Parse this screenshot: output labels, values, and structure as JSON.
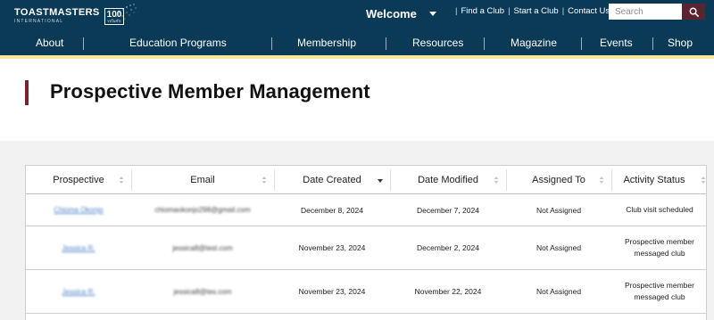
{
  "brand": {
    "name": "TOASTMASTERS",
    "sub": "INTERNATIONAL",
    "badge_number": "100",
    "badge_sub": "YEARS"
  },
  "header": {
    "welcome": "Welcome",
    "links": [
      "Find a Club",
      "Start a Club",
      "Contact Us"
    ],
    "search_placeholder": "Search"
  },
  "nav": [
    "About",
    "Education Programs",
    "Membership",
    "Resources",
    "Magazine",
    "Events",
    "Shop"
  ],
  "page": {
    "title": "Prospective Member Management"
  },
  "table": {
    "columns": [
      "Prospective",
      "Email",
      "Date Created",
      "Date Modified",
      "Assigned To",
      "Activity Status"
    ],
    "rows": [
      {
        "prospective": "Chioma Okonjo",
        "email": "chiomaokonjo298@gmail.com",
        "date_created": "December 8, 2024",
        "date_modified": "December 7, 2024",
        "assigned_to": "Not Assigned",
        "status": "Club visit scheduled"
      },
      {
        "prospective": "Jessica R.",
        "email": "jessica8@test.com",
        "date_created": "November 23, 2024",
        "date_modified": "December 2, 2024",
        "assigned_to": "Not Assigned",
        "status": "Prospective member messaged club"
      },
      {
        "prospective": "Jessica R.",
        "email": "jessica8@tes.com",
        "date_created": "November 23, 2024",
        "date_modified": "November 22, 2024",
        "assigned_to": "Not Assigned",
        "status": "Prospective member messaged club"
      }
    ]
  },
  "colors": {
    "header_bg": "#0b3a57",
    "accent": "#772432",
    "highlight_bar": "#f7e79c",
    "link": "#4a7fc7"
  }
}
